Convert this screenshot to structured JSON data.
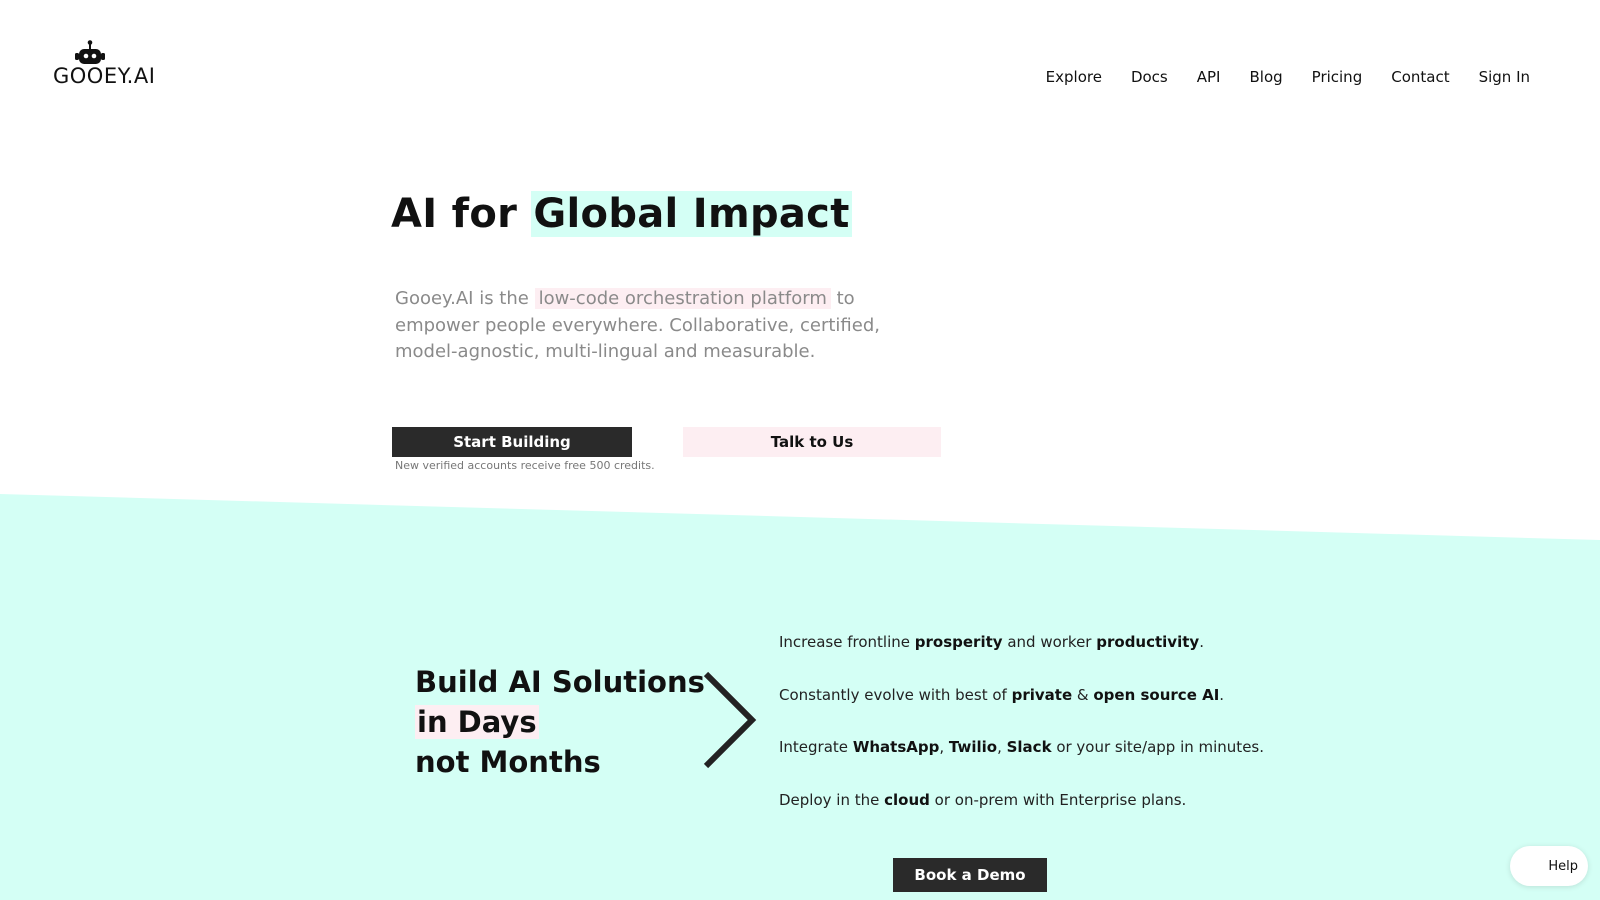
{
  "header": {
    "logo_text": "GOOEY.AI",
    "logo_icon": "robot-icon",
    "nav": [
      {
        "label": "Explore"
      },
      {
        "label": "Docs"
      },
      {
        "label": "API"
      },
      {
        "label": "Blog"
      },
      {
        "label": "Pricing"
      },
      {
        "label": "Contact"
      },
      {
        "label": "Sign In"
      }
    ]
  },
  "hero": {
    "title_prefix": "AI for ",
    "title_highlight": "Global Impact",
    "description": {
      "before": "Gooey.AI is the ",
      "highlight": "low-code orchestration platform",
      "after": " to empower people everywhere. Collaborative, certified, model-agnostic, multi-lingual and measurable."
    },
    "primary_button": "Start Building",
    "credits_note": "New verified accounts receive free 500 credits.",
    "secondary_button": "Talk to Us"
  },
  "solutions": {
    "title_line1": "Build AI Solutions",
    "title_line2": "in Days",
    "title_line3": "not Months",
    "arrow_icon": "chevron-right-icon",
    "features": [
      {
        "parts": [
          "Increase frontline ",
          "prosperity",
          " and worker ",
          "productivity",
          "."
        ]
      },
      {
        "parts": [
          "Constantly evolve with best of ",
          "private",
          " & ",
          "open source AI",
          "."
        ]
      },
      {
        "parts": [
          "Integrate ",
          "WhatsApp",
          ", ",
          "Twilio",
          ", ",
          "Slack",
          " or your site/app in minutes."
        ]
      },
      {
        "parts": [
          "Deploy in the ",
          "cloud",
          " or on-prem with Enterprise plans."
        ]
      }
    ],
    "demo_button": "Book a Demo"
  },
  "help": {
    "label": "Help"
  },
  "colors": {
    "mint": "#d4fff5",
    "pink": "#fdeef2",
    "dark_button": "#2a2a2a"
  }
}
